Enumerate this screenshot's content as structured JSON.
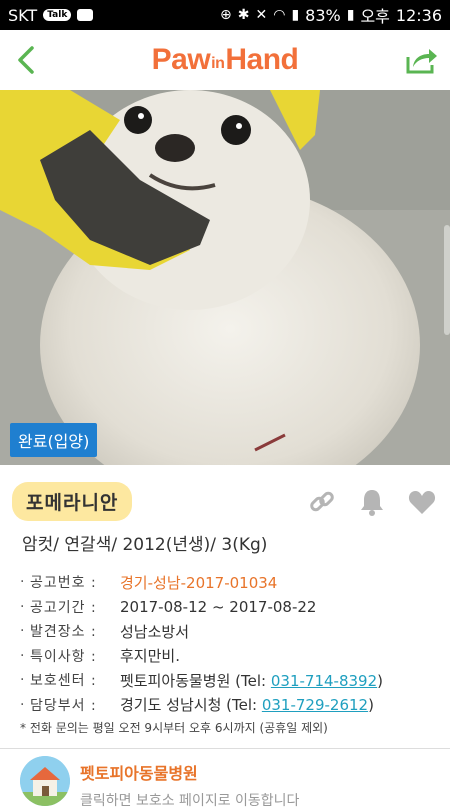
{
  "statusbar": {
    "carrier": "SKT",
    "badge": "Talk",
    "battery": "83%",
    "ampm": "오후",
    "time": "12:36"
  },
  "appbar": {
    "logo_paw": "Paw",
    "logo_in": "in",
    "logo_hand": "Hand",
    "back_icon": "chevron-left-icon",
    "share_icon": "share-icon",
    "accent": "#5ab552",
    "logo_color": "#f2703a"
  },
  "photo": {
    "status_tag": "완료(입양)"
  },
  "animal": {
    "breed": "포메라니안",
    "summary": "암컷/ 연갈색/ 2012(년생)/ 3(Kg)",
    "actions": [
      "link-icon",
      "bell-icon",
      "heart-icon"
    ]
  },
  "details": [
    {
      "label": "공고번호 :",
      "value": "경기-성남-2017-01034",
      "highlight": true
    },
    {
      "label": "공고기간 :",
      "value": "2017-08-12 ~ 2017-08-22"
    },
    {
      "label": "발견장소 :",
      "value": "성남소방서"
    },
    {
      "label": "특이사항 :",
      "value": "후지만비."
    },
    {
      "label": "보호센터 :",
      "value": "펫토피아동물병원 (Tel:",
      "tel": "031-714-8392",
      "suffix": ")"
    },
    {
      "label": "담당부서 :",
      "value": "경기도 성남시청 (Tel:",
      "tel": "031-729-2612",
      "suffix": ")"
    }
  ],
  "note": "* 전화 문의는 평일 오전 9시부터 오후 6시까지 (공휴일 제외)",
  "shelter": {
    "name": "펫토피아동물병원",
    "desc": "클릭하면 보호소 페이지로 이동합니다"
  }
}
